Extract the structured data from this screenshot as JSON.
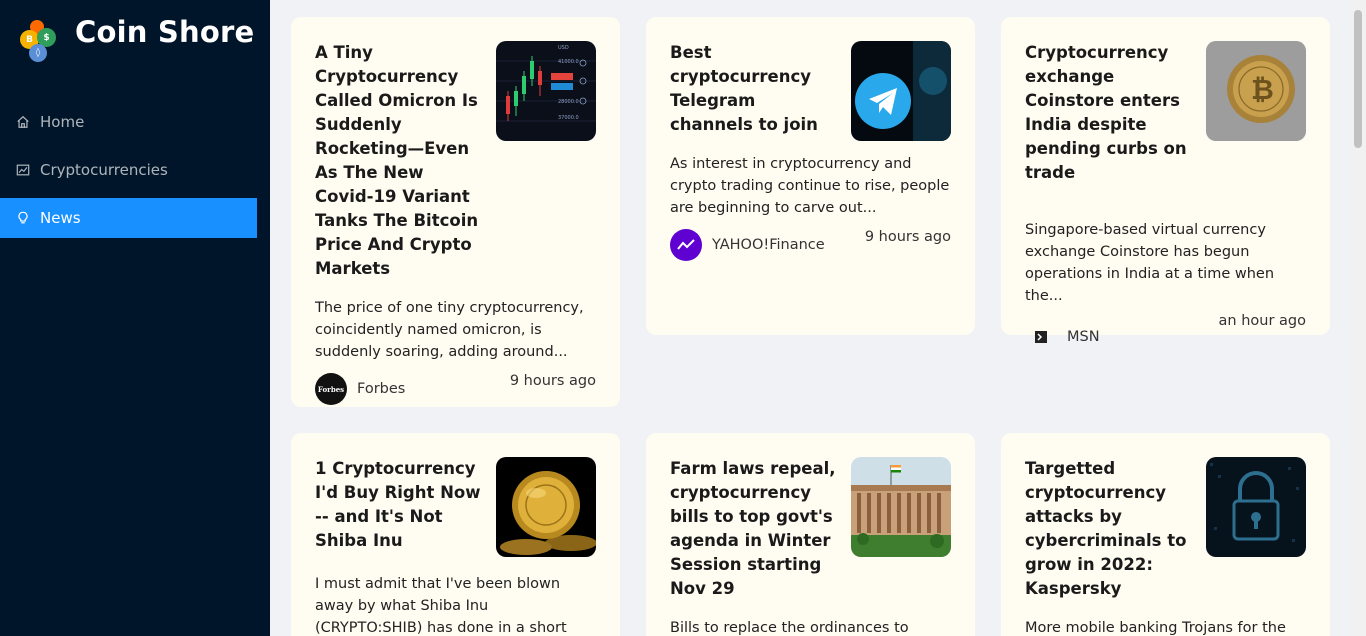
{
  "app": {
    "title": "Coin Shore"
  },
  "sidebar": {
    "items": [
      {
        "label": "Home",
        "icon": "home-icon",
        "active": false
      },
      {
        "label": "Cryptocurrencies",
        "icon": "fund-icon",
        "active": false
      },
      {
        "label": "News",
        "icon": "bulb-icon",
        "active": true
      }
    ]
  },
  "colors": {
    "sidebar_bg": "#001529",
    "accent": "#1890ff",
    "card_bg": "#fffcf2",
    "page_bg": "#f0f2f5"
  },
  "news": [
    {
      "title": "A Tiny Cryptocurrency Called Omicron Is Suddenly Rocketing—Even As The New Covid-19 Variant Tanks The Bitcoin Price And Crypto Markets",
      "description": "The price of one tiny cryptocurrency, coincidently named omicron, is suddenly soaring, adding around...",
      "provider": "Forbes",
      "time": "9 hours ago",
      "image": "trading-chart-image"
    },
    {
      "title": "Best cryptocurrency Telegram channels to join",
      "description": "As interest in cryptocurrency and crypto trading continue to rise, people are beginning to carve out...",
      "provider": "YAHOO!Finance",
      "time": "9 hours ago",
      "image": "telegram-logo-image"
    },
    {
      "title": "Cryptocurrency exchange Coinstore enters India despite pending curbs on trade",
      "description": "Singapore-based virtual currency exchange Coinstore has begun operations in India at a time when the...",
      "provider": "MSN",
      "time": "an hour ago",
      "image": "bitcoin-coin-image"
    },
    {
      "title": "1 Cryptocurrency I'd Buy Right Now -- and It's Not Shiba Inu",
      "description": "I must admit that I've been blown away by what Shiba Inu (CRYPTO:SHIB) has done in a short time. A o...",
      "image": "gold-coins-image"
    },
    {
      "title": "Farm laws repeal, cryptocurrency bills to top govt's agenda in Winter Session starting Nov 29",
      "description": "Bills to replace the ordinances to",
      "image": "parliament-image"
    },
    {
      "title": "Targetted cryptocurrency attacks by cybercriminals to grow in 2022: Kaspersky",
      "description": "More mobile banking Trojans for the",
      "image": "digital-lock-image"
    }
  ],
  "provider_avatars": {
    "forbes_text": "Forbes"
  }
}
